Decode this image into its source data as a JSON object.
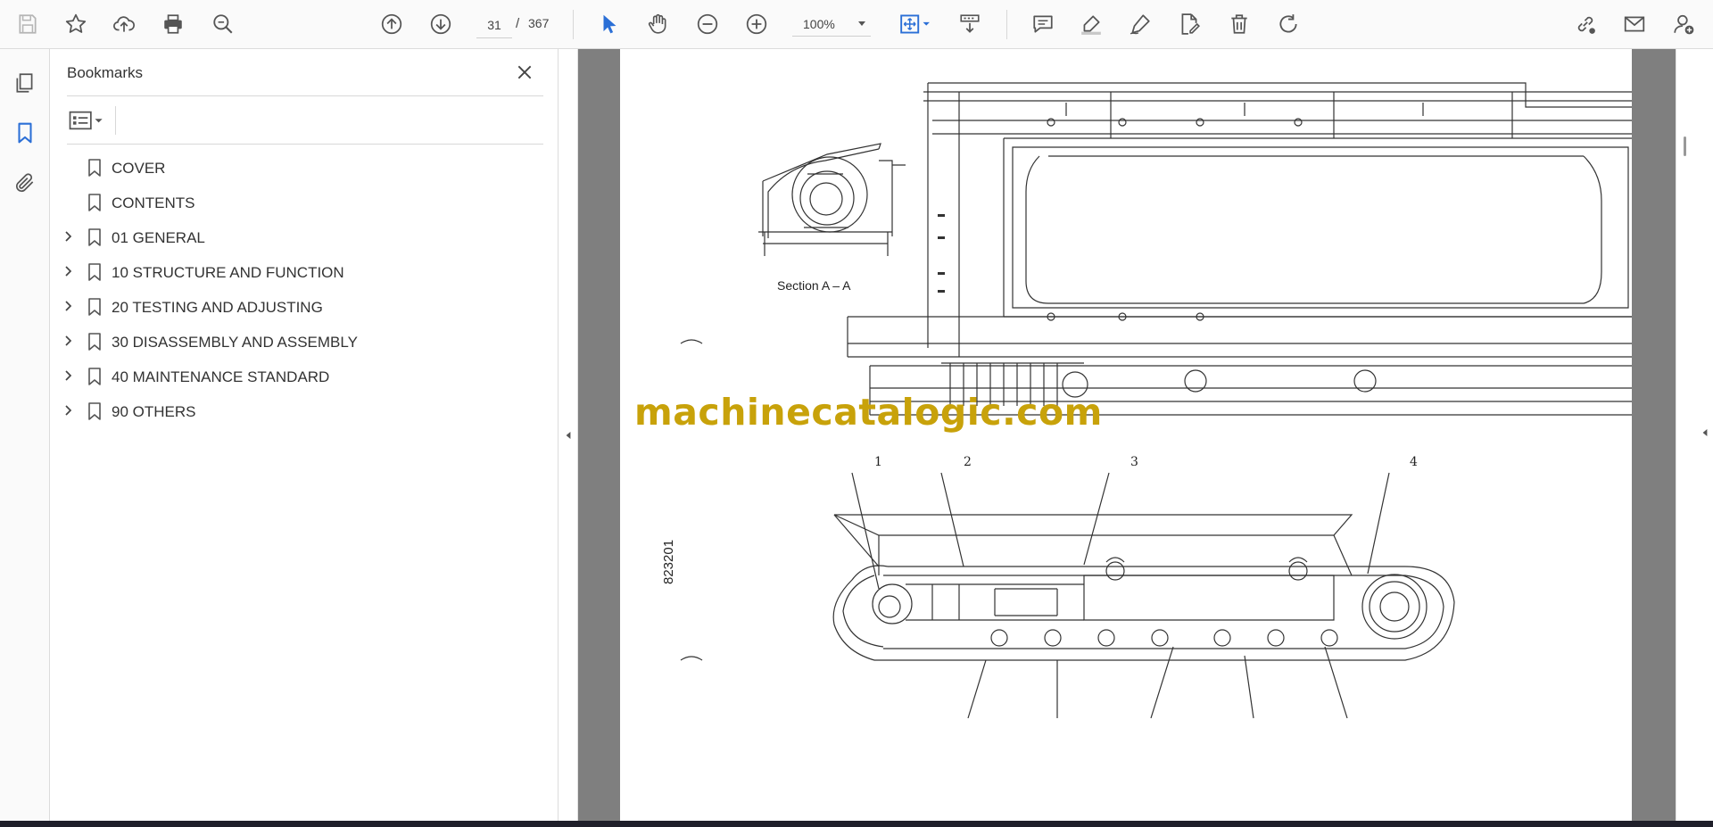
{
  "toolbar": {
    "page_current": "31",
    "page_separator": "/",
    "page_total": "367",
    "zoom": "100%",
    "accent_color": "#2b6fd6"
  },
  "sidebar": {
    "panel_title": "Bookmarks",
    "bookmarks": [
      {
        "label": "COVER",
        "expandable": false
      },
      {
        "label": "CONTENTS",
        "expandable": false
      },
      {
        "label": "01 GENERAL",
        "expandable": true
      },
      {
        "label": "10 STRUCTURE AND FUNCTION",
        "expandable": true
      },
      {
        "label": "20 TESTING AND ADJUSTING",
        "expandable": true
      },
      {
        "label": "30 DISASSEMBLY AND ASSEMBLY",
        "expandable": true
      },
      {
        "label": "40 MAINTENANCE STANDARD",
        "expandable": true
      },
      {
        "label": "90 OTHERS",
        "expandable": true
      }
    ]
  },
  "document": {
    "watermark": "machinecatalogic.com",
    "section_label": "Section A – A",
    "figure_number": "823201",
    "callouts": [
      "1",
      "2",
      "3",
      "4"
    ]
  }
}
